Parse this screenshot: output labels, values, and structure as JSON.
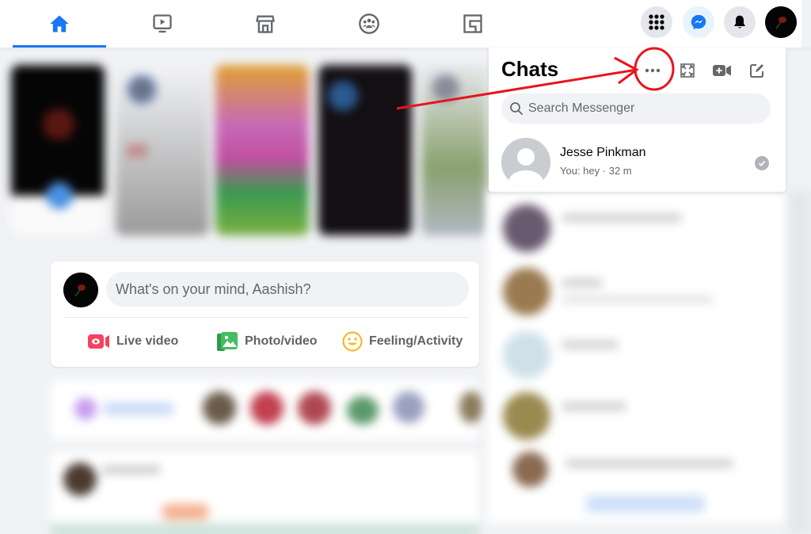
{
  "nav": {
    "tabs": [
      {
        "name": "home",
        "icon": "home-icon",
        "active": true
      },
      {
        "name": "watch",
        "icon": "watch-icon",
        "active": false
      },
      {
        "name": "marketplace",
        "icon": "marketplace-icon",
        "active": false
      },
      {
        "name": "groups",
        "icon": "groups-icon",
        "active": false
      },
      {
        "name": "gaming",
        "icon": "gaming-icon",
        "active": false
      }
    ],
    "right": [
      {
        "name": "menu",
        "icon": "grid-menu-icon"
      },
      {
        "name": "messenger",
        "icon": "messenger-icon",
        "active": true
      },
      {
        "name": "notifications",
        "icon": "bell-icon"
      },
      {
        "name": "account",
        "icon": "profile-avatar"
      }
    ],
    "accent": "#1877f2"
  },
  "composer": {
    "placeholder": "What's on your mind, Aashish?",
    "actions": [
      {
        "label": "Live video",
        "icon": "live-video-icon",
        "color": "#f3425f"
      },
      {
        "label": "Photo/video",
        "icon": "photo-video-icon",
        "color": "#45bd62"
      },
      {
        "label": "Feeling/Activity",
        "icon": "feeling-icon",
        "color": "#f7b928"
      }
    ]
  },
  "chats": {
    "title": "Chats",
    "header_actions": [
      {
        "name": "options",
        "icon": "more-options-icon",
        "highlighted": true
      },
      {
        "name": "see-all-in-messenger",
        "icon": "expand-icon"
      },
      {
        "name": "new-room",
        "icon": "video-plus-icon"
      },
      {
        "name": "new-message",
        "icon": "compose-icon"
      }
    ],
    "search_placeholder": "Search Messenger",
    "conversations": [
      {
        "name": "Jesse Pinkman",
        "preview": "You: hey",
        "separator": "·",
        "time": "32 m",
        "status": "seen"
      }
    ]
  },
  "annotation": {
    "color": "#e8141e",
    "target": "more-options-icon"
  }
}
